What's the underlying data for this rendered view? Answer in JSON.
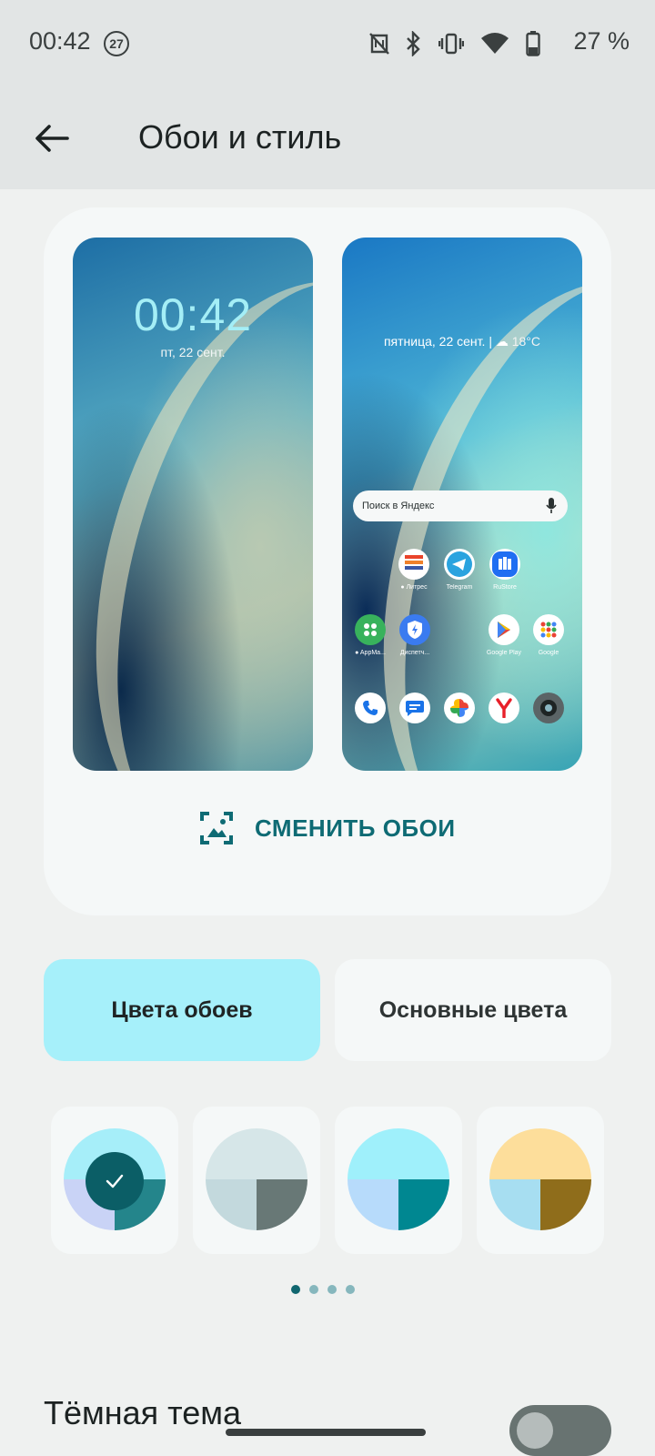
{
  "status_bar": {
    "time": "00:42",
    "notification_badge": "27",
    "battery_text": "27 %",
    "icons": [
      "nfc-off-icon",
      "bluetooth-icon",
      "vibrate-icon",
      "wifi-icon",
      "battery-icon"
    ]
  },
  "app_bar": {
    "title": "Обои и стиль",
    "back_icon": "arrow-back-icon"
  },
  "preview": {
    "lock_screen": {
      "clock": "00:42",
      "date": "пт, 22 сент."
    },
    "home_screen": {
      "date": "пятница, 22 сент.",
      "separator": "|",
      "weather": "18°C",
      "search_placeholder": "Поиск в Яндекс",
      "apps": [
        {
          "label": "● Литрес",
          "icon": "litres-icon"
        },
        {
          "label": "Telegram",
          "icon": "telegram-icon"
        },
        {
          "label": "RuStore",
          "icon": "rustore-icon"
        },
        {
          "label": "● AppMa...",
          "icon": "appmarket-icon"
        },
        {
          "label": "Диспетч...",
          "icon": "phone-manager-icon"
        },
        {
          "label": "Google Play",
          "icon": "google-play-icon"
        },
        {
          "label": "Google",
          "icon": "google-folder-icon"
        }
      ],
      "dock": [
        "phone-icon",
        "messages-icon",
        "photos-icon",
        "yandex-icon",
        "camera-icon"
      ]
    },
    "change_wallpaper_label": "СМЕНИТЬ ОБОИ"
  },
  "color_tabs": {
    "wallpaper_colors": "Цвета обоев",
    "basic_colors": "Основные цвета",
    "selected": "wallpaper_colors"
  },
  "color_options": [
    {
      "top": "#a6eef9",
      "bottom_left": "#c9d3f6",
      "bottom_right": "#24858b",
      "selected": true
    },
    {
      "top": "#d6e6e8",
      "bottom_left": "#c3d9dd",
      "bottom_right": "#687876",
      "selected": false
    },
    {
      "top": "#9ff0fb",
      "bottom_left": "#b7dbfb",
      "bottom_right": "#008791",
      "selected": false
    },
    {
      "top": "#fdde9b",
      "bottom_left": "#a7def1",
      "bottom_right": "#8f6d1b",
      "selected": false
    }
  ],
  "pager": {
    "count": 4,
    "active": 0
  },
  "dark_theme": {
    "label": "Тёмная тема",
    "enabled": false
  }
}
